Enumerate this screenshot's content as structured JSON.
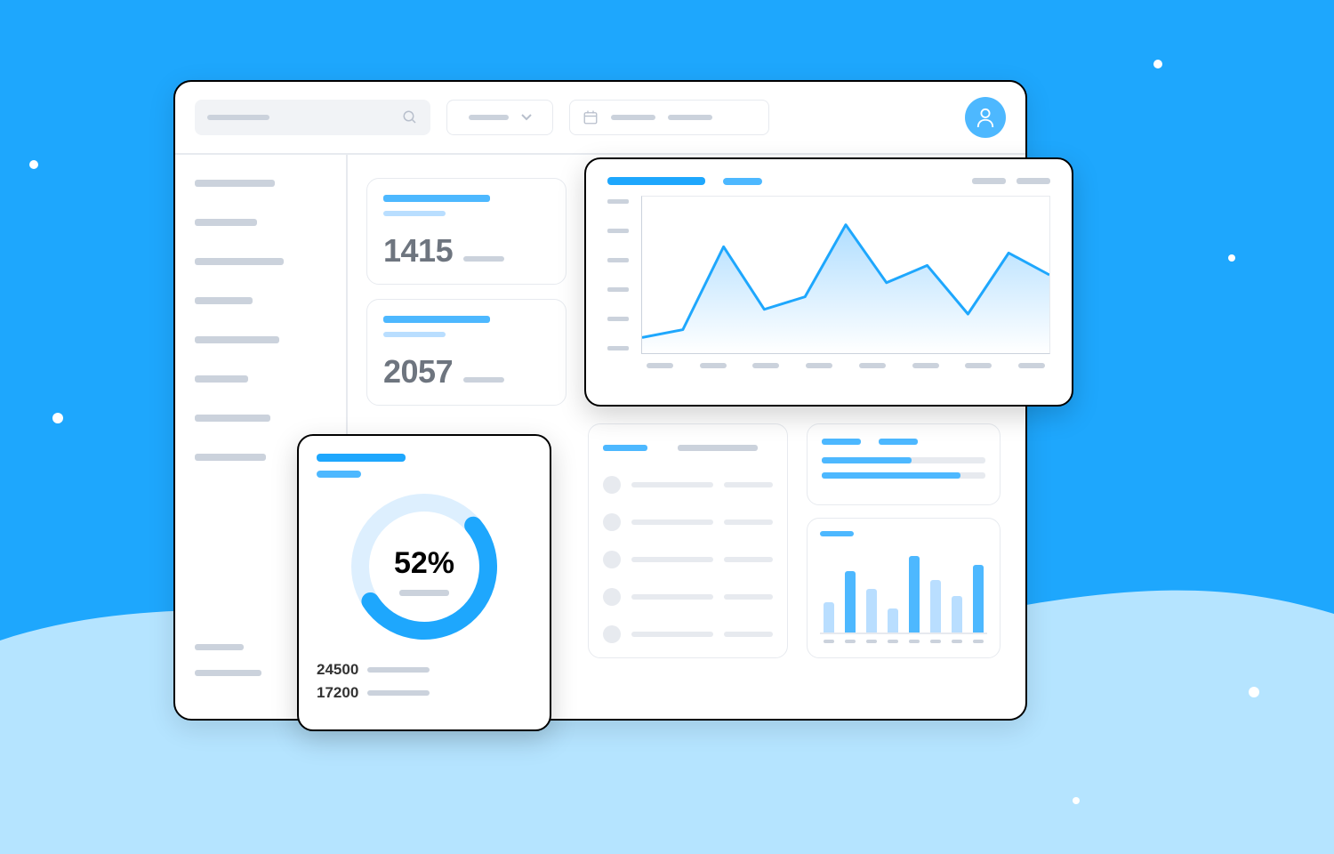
{
  "colors": {
    "accent": "#1EA7FD",
    "accent_light": "#4DB8FF",
    "pale": "#B9DEFF",
    "muted": "#CBD2DC",
    "border": "#E7EAEF"
  },
  "sidebar": {
    "items_top": [
      90,
      70,
      100,
      65,
      95,
      60,
      85,
      80
    ],
    "items_bottom": [
      55,
      75
    ]
  },
  "kpis": [
    {
      "value": "1415"
    },
    {
      "value": "2057"
    }
  ],
  "donut": {
    "percent_label": "52%",
    "percent": 52,
    "stats": [
      {
        "value": "24500"
      },
      {
        "value": "17200"
      }
    ]
  },
  "progress": {
    "bars": [
      55,
      85
    ]
  },
  "list": {
    "rows": 5
  },
  "chart_data": [
    {
      "type": "line",
      "title": "",
      "x_ticks": 8,
      "y_ticks": 6,
      "ylim": [
        0,
        100
      ],
      "series": [
        {
          "name": "series-1",
          "values": [
            10,
            15,
            68,
            28,
            36,
            82,
            45,
            56,
            25,
            64,
            50
          ]
        }
      ]
    },
    {
      "type": "bar",
      "title": "",
      "ylim": [
        0,
        100
      ],
      "series": [
        {
          "name": "all-bars",
          "colors": [
            "pale",
            "accent",
            "pale",
            "pale",
            "accent",
            "pale",
            "pale",
            "accent"
          ],
          "values": [
            35,
            70,
            50,
            28,
            88,
            60,
            42,
            78
          ]
        }
      ]
    },
    {
      "type": "pie",
      "title": "",
      "series": [
        {
          "name": "filled",
          "value": 52
        },
        {
          "name": "remainder",
          "value": 48
        }
      ]
    }
  ]
}
